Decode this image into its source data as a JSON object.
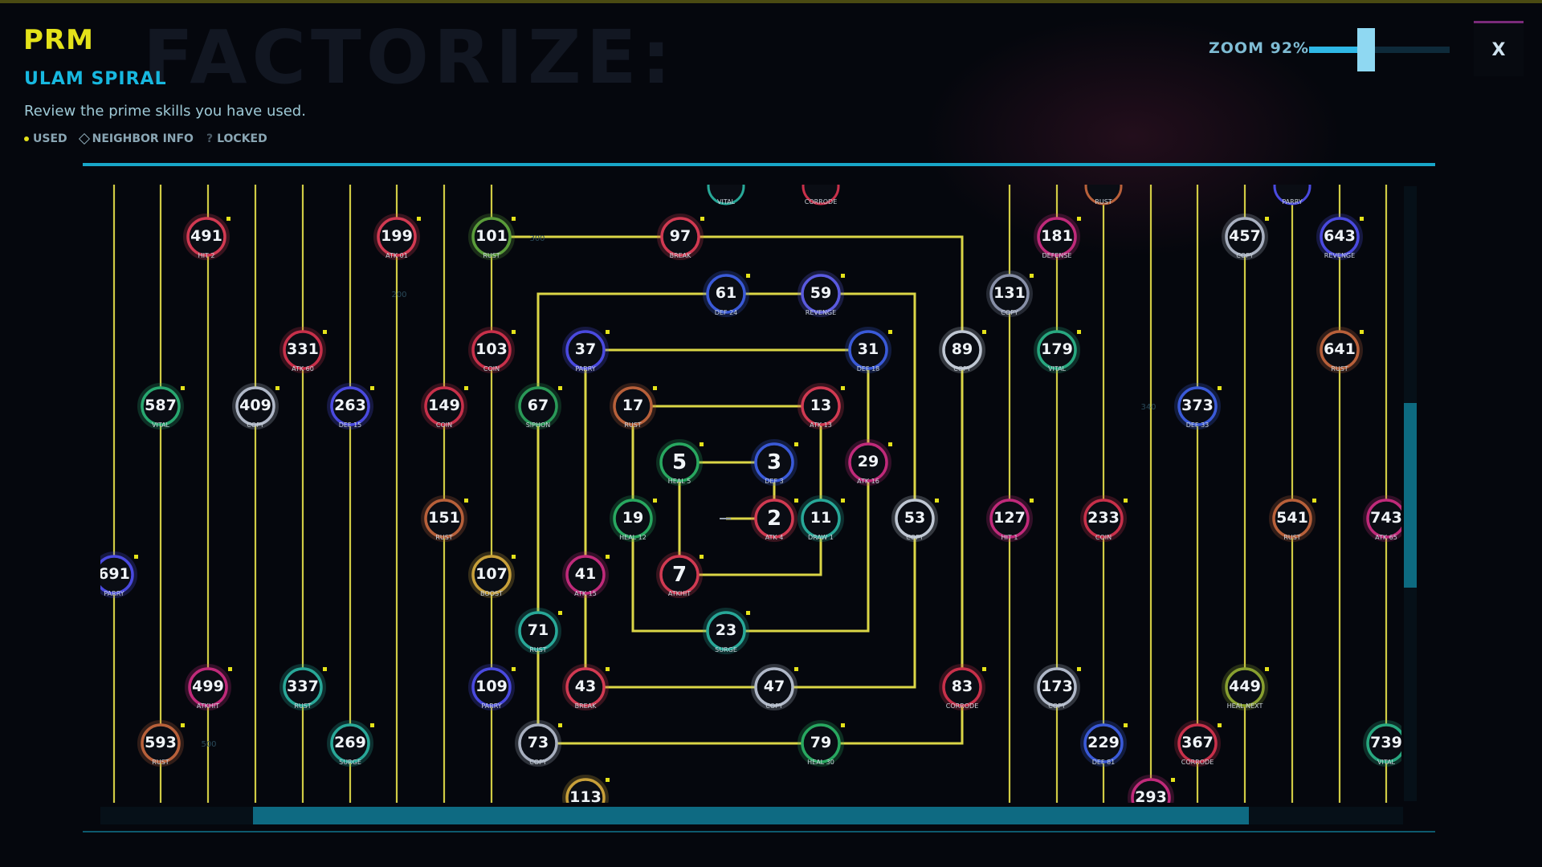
{
  "header": {
    "code": "PRM",
    "bg_title": "FACTORIZE:",
    "subtitle": "ULAM SPIRAL",
    "description": "Review the prime skills you have used.",
    "legend": {
      "used": "USED",
      "neighbor": "NEIGHBOR INFO",
      "locked_mark": "?",
      "locked": "LOCKED"
    }
  },
  "zoom": {
    "label": "ZOOM 92%",
    "value": 0.92
  },
  "close_button": {
    "label": "X"
  },
  "scroll": {
    "vertical_fraction": 0.25,
    "horizontal_fraction": 0.62
  },
  "colors": {
    "accent": "#e4e21a",
    "cyan": "#18a6c8",
    "line": "#e7e14a"
  },
  "spiral": {
    "grid_step": 2,
    "nodes": [
      {
        "n": "491",
        "label": "HIT 2",
        "color": "#d23a52",
        "used": true
      },
      {
        "n": "199",
        "label": "ATK 01",
        "color": "#d23a52",
        "used": true
      },
      {
        "n": "101",
        "label": "RUST",
        "color": "#5a9c3a",
        "used": true
      },
      {
        "n": "97",
        "label": "BREAK",
        "color": "#d23a52",
        "used": true
      },
      {
        "n": "181",
        "label": "DEFENSE",
        "color": "#c02a7a",
        "used": true
      },
      {
        "n": "457",
        "label": "COPY",
        "color": "#a8b0c0",
        "used": true
      },
      {
        "n": "643",
        "label": "REVENGE",
        "color": "#4a4ae0",
        "used": true
      },
      {
        "n": "61",
        "label": "DEF 24",
        "color": "#3a5ad8",
        "used": true
      },
      {
        "n": "59",
        "label": "REVENGE",
        "color": "#5a5ae0",
        "used": true
      },
      {
        "n": "131",
        "label": "COPY",
        "color": "#8890a8",
        "used": true
      },
      {
        "n": "331",
        "label": "ATK 60",
        "color": "#c8304a",
        "used": true
      },
      {
        "n": "103",
        "label": "COIN",
        "color": "#c8304a",
        "used": true
      },
      {
        "n": "37",
        "label": "PARRY",
        "color": "#4a4ae0",
        "used": true
      },
      {
        "n": "31",
        "label": "DEF 18",
        "color": "#3a5ad8",
        "used": true
      },
      {
        "n": "89",
        "label": "COPY",
        "color": "#c0c8d4",
        "used": true
      },
      {
        "n": "179",
        "label": "VITAL",
        "color": "#28a880",
        "used": true
      },
      {
        "n": "641",
        "label": "RUST",
        "color": "#b8603a",
        "used": true
      },
      {
        "n": "587",
        "label": "VITAL",
        "color": "#28a870",
        "used": true
      },
      {
        "n": "409",
        "label": "COPY",
        "color": "#b0b8c8",
        "used": true
      },
      {
        "n": "263",
        "label": "DEF 15",
        "color": "#4a4ae0",
        "used": true
      },
      {
        "n": "149",
        "label": "COIN",
        "color": "#c8304a",
        "used": true
      },
      {
        "n": "67",
        "label": "SIPHON",
        "color": "#2a9a58",
        "used": true
      },
      {
        "n": "17",
        "label": "RUST",
        "color": "#b8603a",
        "used": true
      },
      {
        "n": "13",
        "label": "ATK 13",
        "color": "#d23a52",
        "used": true
      },
      {
        "n": "373",
        "label": "DEF 33",
        "color": "#3a5ad8",
        "used": true
      },
      {
        "n": "5",
        "label": "HEAL 5",
        "color": "#28a860",
        "used": true
      },
      {
        "n": "3",
        "label": "DEF 3",
        "color": "#3a5ad8",
        "used": true
      },
      {
        "n": "29",
        "label": "ATK 16",
        "color": "#c02a7a",
        "used": true
      },
      {
        "n": "151",
        "label": "RUST",
        "color": "#b8603a",
        "used": true
      },
      {
        "n": "19",
        "label": "HEAL 12",
        "color": "#28a860",
        "used": true
      },
      {
        "n": "2",
        "label": "ATK 4",
        "color": "#d23a52",
        "used": true
      },
      {
        "n": "11",
        "label": "DRAW 1",
        "color": "#28a898",
        "used": true
      },
      {
        "n": "53",
        "label": "COPY",
        "color": "#c0c8d4",
        "used": true
      },
      {
        "n": "127",
        "label": "HIT 1",
        "color": "#c02a7a",
        "used": true
      },
      {
        "n": "233",
        "label": "COIN",
        "color": "#c8304a",
        "used": true
      },
      {
        "n": "541",
        "label": "RUST",
        "color": "#b8603a",
        "used": true
      },
      {
        "n": "743",
        "label": "ATK 65",
        "color": "#c02a7a",
        "used": true
      },
      {
        "n": "691",
        "label": "PARRY",
        "color": "#4a4ae0",
        "used": true
      },
      {
        "n": "107",
        "label": "BOOST",
        "color": "#c8a03a",
        "used": true
      },
      {
        "n": "41",
        "label": "ATK 15",
        "color": "#c02a7a",
        "used": true
      },
      {
        "n": "7",
        "label": "ATKHIT",
        "color": "#d23a52",
        "used": true
      },
      {
        "n": "71",
        "label": "RUST",
        "color": "#28a898",
        "used": true
      },
      {
        "n": "23",
        "label": "SURGE",
        "color": "#28a898",
        "used": true
      },
      {
        "n": "499",
        "label": "ATKHIT",
        "color": "#c02a7a",
        "used": true
      },
      {
        "n": "337",
        "label": "RUST",
        "color": "#28a898",
        "used": true
      },
      {
        "n": "109",
        "label": "PARRY",
        "color": "#4a4ae0",
        "used": true
      },
      {
        "n": "43",
        "label": "BREAK",
        "color": "#d23a52",
        "used": true
      },
      {
        "n": "47",
        "label": "COPY",
        "color": "#b0b8c8",
        "used": true
      },
      {
        "n": "83",
        "label": "CORRODE",
        "color": "#c8304a",
        "used": true
      },
      {
        "n": "173",
        "label": "COPY",
        "color": "#b0b8c8",
        "used": true
      },
      {
        "n": "449",
        "label": "HEAL NEXT",
        "color": "#88a030",
        "used": true
      },
      {
        "n": "593",
        "label": "RUST",
        "color": "#b8603a",
        "used": true
      },
      {
        "n": "269",
        "label": "SURGE",
        "color": "#28a898",
        "used": true
      },
      {
        "n": "73",
        "label": "COPY",
        "color": "#a8b0c0",
        "used": true
      },
      {
        "n": "79",
        "label": "HEAL 30",
        "color": "#28a860",
        "used": true
      },
      {
        "n": "229",
        "label": "DEF 81",
        "color": "#3a5ad8",
        "used": true
      },
      {
        "n": "367",
        "label": "CORRODE",
        "color": "#c8304a",
        "used": true
      },
      {
        "n": "739",
        "label": "VITAL",
        "color": "#28a880",
        "used": true
      },
      {
        "n": "113",
        "label": "",
        "color": "#c8a03a",
        "used": true
      },
      {
        "n": "293",
        "label": "",
        "color": "#c02a7a",
        "used": true
      },
      {
        "n": "",
        "label": "VITAL",
        "color": "#28a898",
        "used": true
      },
      {
        "n": "",
        "label": "CORRODE",
        "color": "#c8304a",
        "used": true
      },
      {
        "n": "",
        "label": "RUST",
        "color": "#b8603a",
        "used": true
      },
      {
        "n": "",
        "label": "PARRY",
        "color": "#4a4ae0",
        "used": true
      }
    ],
    "faint_marks": [
      "200",
      "300",
      "340",
      "500"
    ]
  }
}
